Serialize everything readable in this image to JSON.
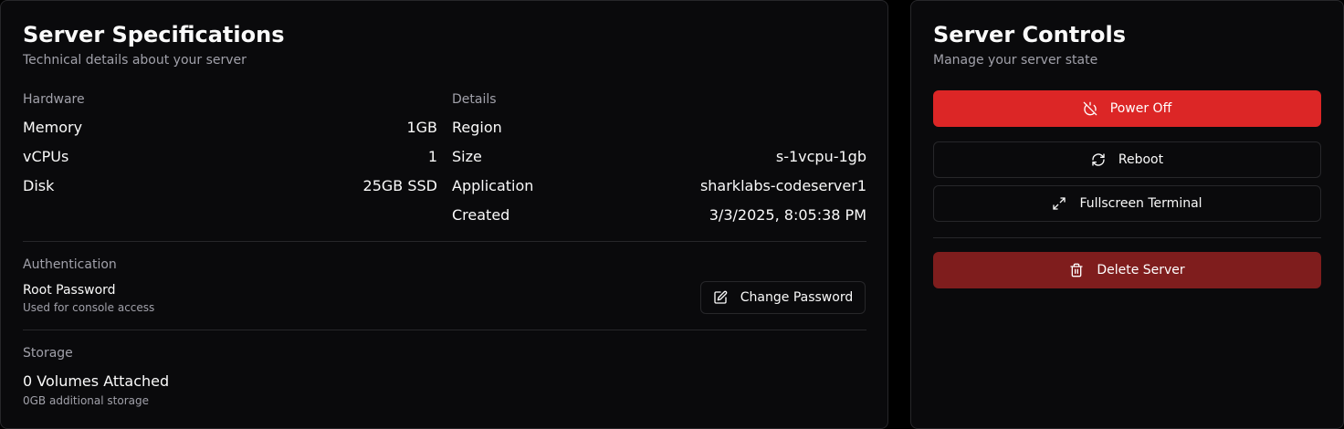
{
  "specs": {
    "title": "Server Specifications",
    "subtitle": "Technical details about your server",
    "hardware": {
      "label": "Hardware",
      "rows": [
        {
          "key": "Memory",
          "value": "1GB"
        },
        {
          "key": "vCPUs",
          "value": "1"
        },
        {
          "key": "Disk",
          "value": "25GB SSD"
        }
      ]
    },
    "details": {
      "label": "Details",
      "rows": [
        {
          "key": "Region",
          "value": ""
        },
        {
          "key": "Size",
          "value": "s-1vcpu-1gb"
        },
        {
          "key": "Application",
          "value": "sharklabs-codeserver1"
        },
        {
          "key": "Created",
          "value": "3/3/2025, 8:05:38 PM"
        }
      ]
    },
    "authentication": {
      "label": "Authentication",
      "item_title": "Root Password",
      "item_description": "Used for console access",
      "button_label": "Change Password",
      "button_icon": "pencil-square-icon"
    },
    "storage": {
      "label": "Storage",
      "volumes_text": "0 Volumes Attached",
      "additional_text": "0GB additional storage"
    }
  },
  "controls": {
    "title": "Server Controls",
    "subtitle": "Manage your server state",
    "buttons": [
      {
        "label": "Power Off",
        "icon": "power-off-icon",
        "style": "danger",
        "color": "#dc2626"
      },
      {
        "label": "Reboot",
        "icon": "refresh-icon",
        "style": "outline"
      },
      {
        "label": "Fullscreen Terminal",
        "icon": "expand-icon",
        "style": "outline"
      },
      {
        "label": "Delete Server",
        "icon": "trash-icon",
        "style": "danger-dark",
        "color": "#7f1d1d"
      }
    ]
  },
  "colors": {
    "background": "#000000",
    "card": "#0a0a0c",
    "border": "#27272a",
    "text": "#fafafa",
    "muted": "#a1a1aa"
  }
}
